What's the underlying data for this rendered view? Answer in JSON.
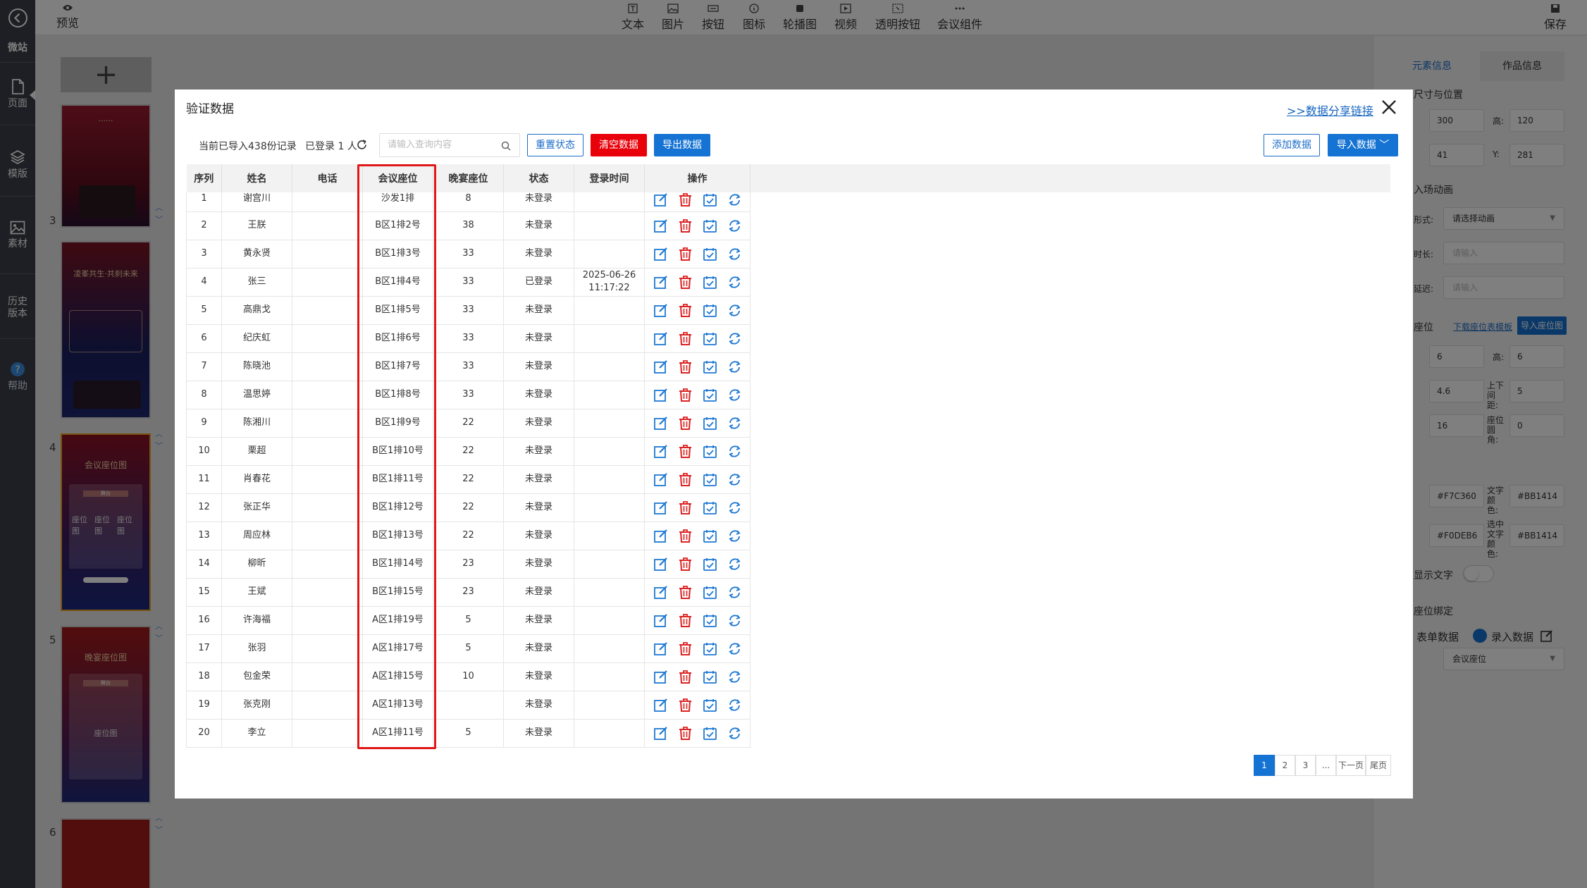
{
  "sidebar": {
    "items": [
      {
        "label": "微站",
        "icon": "site-icon"
      },
      {
        "label": "页面",
        "icon": "page-icon"
      },
      {
        "label": "模版",
        "icon": "layers-icon"
      },
      {
        "label": "素材",
        "icon": "image-icon"
      },
      {
        "label": "历史版本",
        "icon": "history-icon"
      },
      {
        "label": "帮助",
        "icon": "help-icon"
      }
    ]
  },
  "topbar": {
    "preview": "预览",
    "tools": [
      "文本",
      "图片",
      "按钮",
      "图标",
      "轮播图",
      "视频",
      "透明按钮",
      "会议组件"
    ],
    "save": "保存"
  },
  "thumbs": {
    "add": "+",
    "pages": [
      {
        "num": "3",
        "theme": "red",
        "heading": "......"
      },
      {
        "num": "4",
        "theme": "blue",
        "heading": "凌峯共生·共刹未来"
      },
      {
        "num": "5",
        "theme": "red-blue",
        "heading": "会议座位图",
        "inner": [
          "舞台",
          "座位图",
          "座位图",
          "座位图"
        ]
      },
      {
        "num": "6",
        "theme": "red-blue",
        "heading": "晚宴座位图",
        "inner": [
          "舞台",
          "座位图"
        ]
      }
    ]
  },
  "rightpanel": {
    "tabs": [
      "元素信息",
      "作品信息"
    ],
    "size_title": "尺寸与位置",
    "width_value": "300",
    "height_label": "高:",
    "height_value": "120",
    "x_value": "41",
    "y_label": "Y:",
    "y_value": "281",
    "anim_title": "入场动画",
    "anim_form_label": "形式:",
    "anim_form_value": "请选择动画",
    "anim_dur_label": "时长:",
    "anim_dur_ph": "请输入",
    "anim_delay_label": "延迟:",
    "anim_delay_ph": "请输入",
    "seat_title": "座位",
    "seat_download": "下载座位表模板",
    "seat_import": "导入座位图",
    "seat_w": "6",
    "seat_h_label": "高:",
    "seat_h": "6",
    "gap_x": "4.6",
    "gap_y_label": "上下间距:",
    "gap_y": "5",
    "font_size": "16",
    "radius_label": "座位圆角:",
    "radius": "0",
    "color_bg": "#F7C360",
    "text_color_label": "文字颜色:",
    "text_color": "#BB1414",
    "color_sel_bg": "#F0DEB6",
    "sel_text_color_label": "选中文字颜色:",
    "sel_text_color": "#BB1414",
    "show_text": "显示文字",
    "bind_title": "座位绑定",
    "bind_form": "表单数据",
    "bind_entry": "录入数据",
    "bind_field": "会议座位"
  },
  "modal": {
    "title": "验证数据",
    "share_link": ">>数据分享链接",
    "count_text": "当前已导入438份记录",
    "login_text": "已登录 1 人",
    "search_placeholder": "请输入查询内容",
    "btn_reset": "重置状态",
    "btn_clear": "清空数据",
    "btn_export": "导出数据",
    "btn_add": "添加数据",
    "btn_import": "导入数据 ﹀",
    "table": {
      "columns": [
        "序列",
        "姓名",
        "电话",
        "会议座位",
        "晚宴座位",
        "状态",
        "登录时间",
        "操作"
      ],
      "rows": [
        [
          "1",
          "谢宫川",
          "",
          "沙发1排",
          "8",
          "未登录",
          ""
        ],
        [
          "2",
          "王朕",
          "",
          "B区1排2号",
          "38",
          "未登录",
          ""
        ],
        [
          "3",
          "黄永贤",
          "",
          "B区1排3号",
          "33",
          "未登录",
          ""
        ],
        [
          "4",
          "张三",
          "",
          "B区1排4号",
          "33",
          "已登录",
          "2025-06-26 11:17:22"
        ],
        [
          "5",
          "高鼎戈",
          "",
          "B区1排5号",
          "33",
          "未登录",
          ""
        ],
        [
          "6",
          "纪庆虹",
          "",
          "B区1排6号",
          "33",
          "未登录",
          ""
        ],
        [
          "7",
          "陈晓池",
          "",
          "B区1排7号",
          "33",
          "未登录",
          ""
        ],
        [
          "8",
          "温思婷",
          "",
          "B区1排8号",
          "33",
          "未登录",
          ""
        ],
        [
          "9",
          "陈湘川",
          "",
          "B区1排9号",
          "22",
          "未登录",
          ""
        ],
        [
          "10",
          "栗超",
          "",
          "B区1排10号",
          "22",
          "未登录",
          ""
        ],
        [
          "11",
          "肖春花",
          "",
          "B区1排11号",
          "22",
          "未登录",
          ""
        ],
        [
          "12",
          "张正华",
          "",
          "B区1排12号",
          "22",
          "未登录",
          ""
        ],
        [
          "13",
          "周应林",
          "",
          "B区1排13号",
          "22",
          "未登录",
          ""
        ],
        [
          "14",
          "柳昕",
          "",
          "B区1排14号",
          "23",
          "未登录",
          ""
        ],
        [
          "15",
          "王斌",
          "",
          "B区1排15号",
          "23",
          "未登录",
          ""
        ],
        [
          "16",
          "许海福",
          "",
          "A区1排19号",
          "5",
          "未登录",
          ""
        ],
        [
          "17",
          "张羽",
          "",
          "A区1排17号",
          "5",
          "未登录",
          ""
        ],
        [
          "18",
          "包金荣",
          "",
          "A区1排15号",
          "10",
          "未登录",
          ""
        ],
        [
          "19",
          "张克刚",
          "",
          "A区1排13号",
          "",
          "未登录",
          ""
        ],
        [
          "20",
          "李立",
          "",
          "A区1排11号",
          "5",
          "未登录",
          ""
        ]
      ]
    },
    "pagination": [
      "1",
      "2",
      "3",
      "...",
      "下一页",
      "尾页"
    ]
  }
}
